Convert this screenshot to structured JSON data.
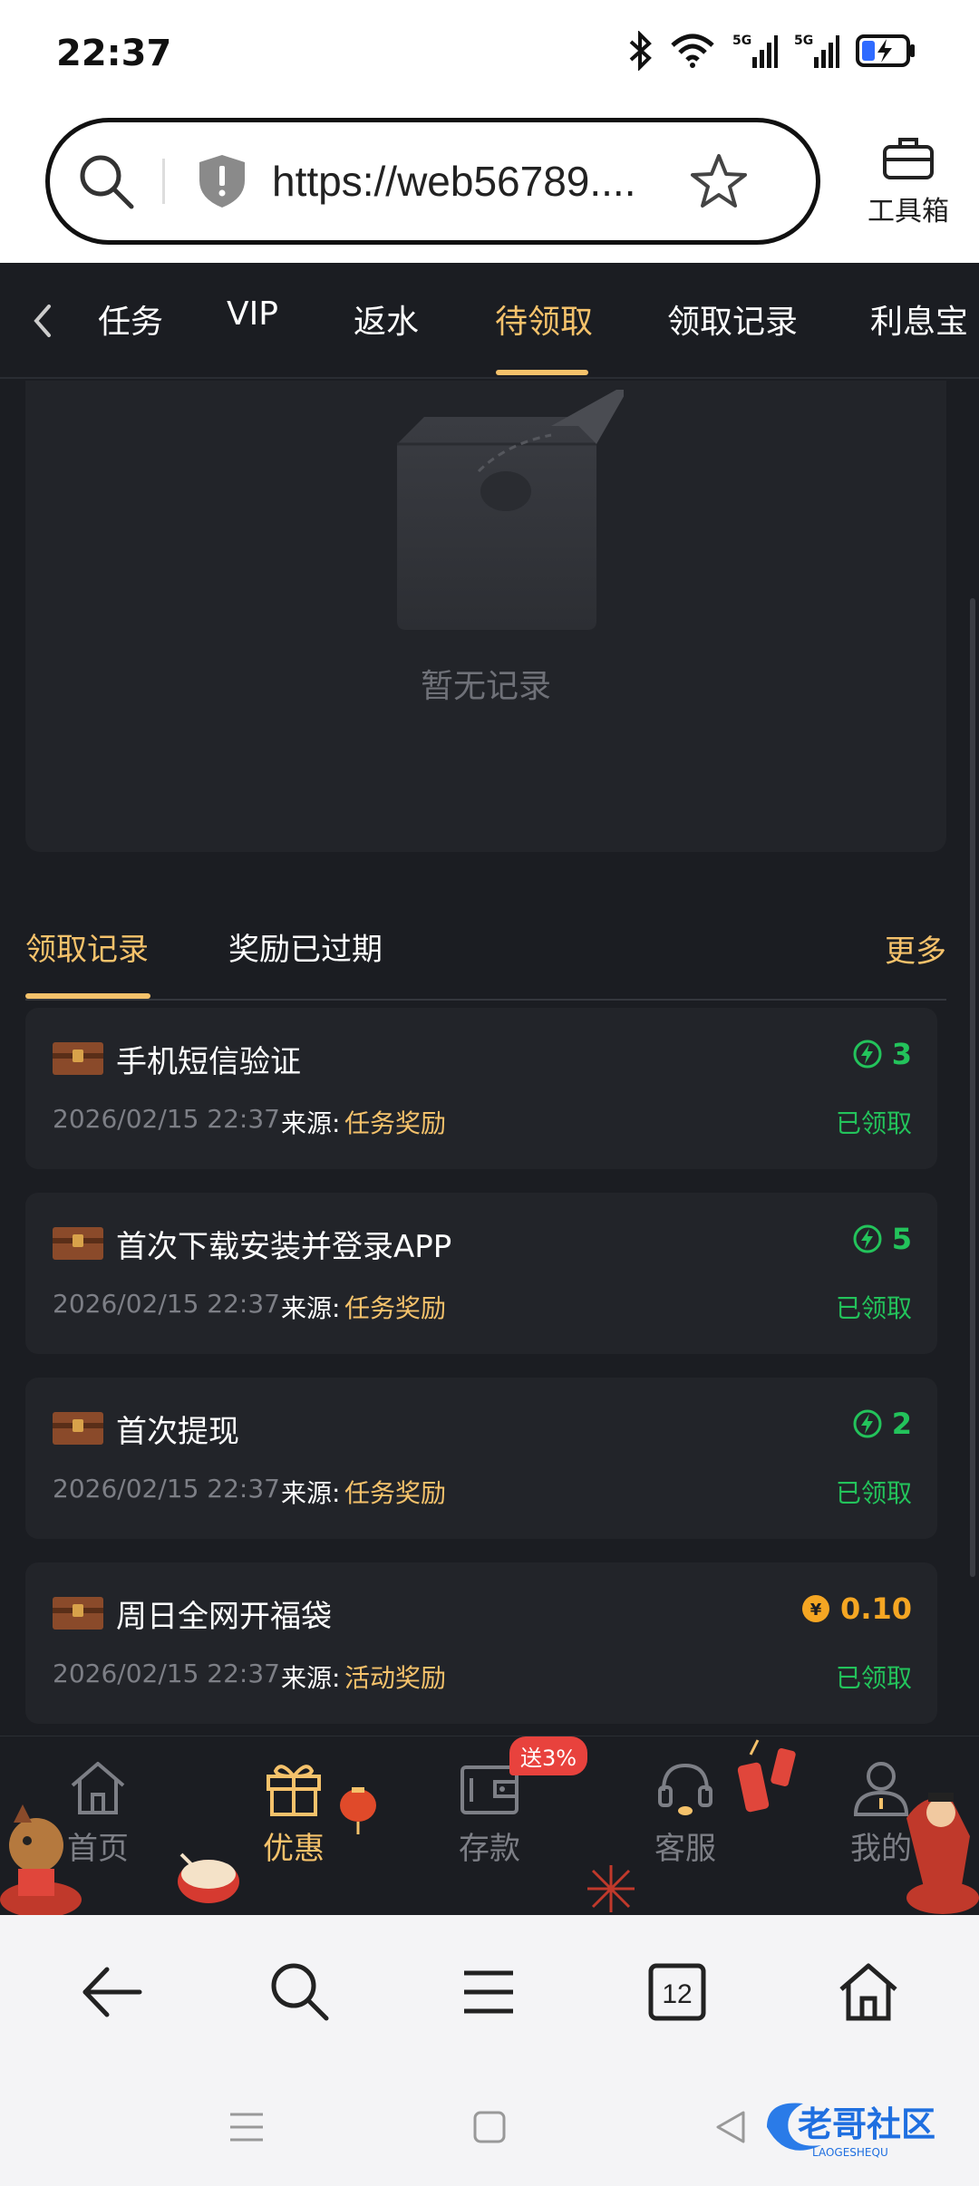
{
  "status_bar": {
    "time": "22:37",
    "icons": [
      "bluetooth-icon",
      "wifi-icon",
      "signal-5g-icon",
      "signal-5g-icon",
      "battery-charging-icon"
    ],
    "network_label": "5G"
  },
  "browser": {
    "url": "https://web56789....",
    "toolbox_label": "工具箱"
  },
  "tabs": {
    "items": [
      "任务",
      "VIP",
      "返水",
      "待领取",
      "领取记录",
      "利息宝"
    ],
    "active": "待领取"
  },
  "empty_state": {
    "text": "暂无记录"
  },
  "sub_tabs": {
    "items": [
      "领取记录",
      "奖励已过期"
    ],
    "active": "领取记录",
    "more_label": "更多"
  },
  "records": [
    {
      "title": "手机短信验证",
      "amount": "3",
      "amount_type": "bolt",
      "date": "2026/02/15 22:37",
      "source_label": "来源:",
      "source": "任务奖励",
      "status": "已领取"
    },
    {
      "title": "首次下载安装并登录APP",
      "amount": "5",
      "amount_type": "bolt",
      "date": "2026/02/15 22:37",
      "source_label": "来源:",
      "source": "任务奖励",
      "status": "已领取"
    },
    {
      "title": "首次提现",
      "amount": "2",
      "amount_type": "bolt",
      "date": "2026/02/15 22:37",
      "source_label": "来源:",
      "source": "任务奖励",
      "status": "已领取"
    },
    {
      "title": "周日全网开福袋",
      "amount": "0.10",
      "amount_type": "coin",
      "date": "2026/02/15 22:37",
      "source_label": "来源:",
      "source": "活动奖励",
      "status": "已领取"
    }
  ],
  "app_nav": {
    "items": [
      "首页",
      "优惠",
      "存款",
      "客服",
      "我的"
    ],
    "active": "优惠",
    "promo_badge": "送3%"
  },
  "browser_toolbar": {
    "tab_count": "12"
  },
  "watermark": {
    "text": "老哥社区",
    "subtext": "LAOGESHEQU"
  },
  "colors": {
    "accent": "#f5c26b",
    "success": "#23c35b",
    "coin": "#f5a623",
    "background": "#1b1d22",
    "card": "#222429"
  }
}
